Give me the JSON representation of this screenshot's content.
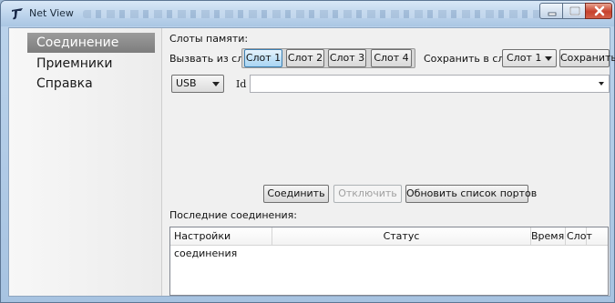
{
  "window": {
    "title": "Net View"
  },
  "sidebar": {
    "items": [
      {
        "label": "Соединение",
        "active": true
      },
      {
        "label": "Приемники",
        "active": false
      },
      {
        "label": "Справка",
        "active": false
      }
    ]
  },
  "memory": {
    "section_label": "Слоты памяти:",
    "load_label": "Вызвать из слота:",
    "slots": [
      "Слот 1",
      "Слот 2",
      "Слот 3",
      "Слот 4"
    ],
    "selected_slot": "Слот 1",
    "save_label": "Сохранить в слот:",
    "save_slot_value": "Слот 1",
    "save_button": "Сохранить"
  },
  "connection": {
    "port_type": "USB",
    "id_label": "Id",
    "id_value": "",
    "connect_button": "Соединить",
    "disconnect_button": "Отключить",
    "refresh_button": "Обновить список портов"
  },
  "recent": {
    "title": "Последние соединения:",
    "columns": [
      "Настройки соединения",
      "Статус",
      "Время",
      "Слот"
    ],
    "rows": []
  },
  "colors": {
    "accent": "#3c7fb1",
    "sidebar_active": "#8a8a8a",
    "close_button": "#c7412c"
  }
}
